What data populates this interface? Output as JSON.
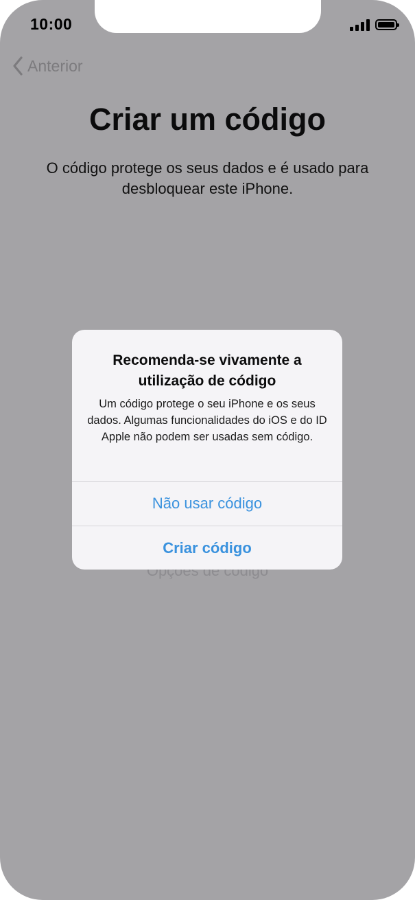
{
  "status_bar": {
    "time": "10:00",
    "signal_bars": 4,
    "battery_level": 1.0
  },
  "nav": {
    "back_label": "Anterior"
  },
  "screen": {
    "title": "Criar um código",
    "subtitle": "O código protege os seus dados e é usado para desbloquear este iPhone.",
    "options_label": "Opções de código"
  },
  "alert": {
    "title": "Recomenda-se vivamente a utilização de código",
    "message": "Um código protege o seu iPhone e os seus dados. Algumas funcionalidades do iOS e do ID Apple não podem ser usadas sem código.",
    "buttons": [
      {
        "label": "Não usar código"
      },
      {
        "label": "Criar código"
      }
    ]
  },
  "colors": {
    "dim_background": "#a4a3a6",
    "alert_background": "#f5f4f7",
    "accent": "#3a92de"
  },
  "icons": {
    "back": "chevron-left-icon",
    "signal": "cellular-signal-icon",
    "battery": "battery-icon"
  }
}
